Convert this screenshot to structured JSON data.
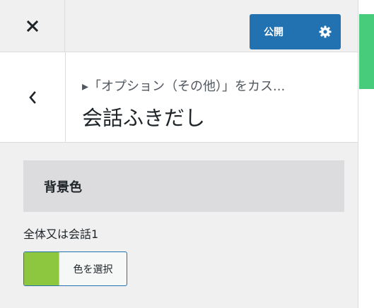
{
  "topbar": {
    "close_icon": "close-icon",
    "publish_label": "公開",
    "gear_icon": "gear-icon",
    "accent_color": "#2271b1"
  },
  "section": {
    "back_icon": "chevron-left-icon",
    "breadcrumb": "▸「オプション（その他）」をカス...",
    "title": "会話ふきだし"
  },
  "control": {
    "heading": "背景色",
    "label": "全体又は会話1",
    "picker_label": "色を選択",
    "current_color": "#8dc63f"
  }
}
